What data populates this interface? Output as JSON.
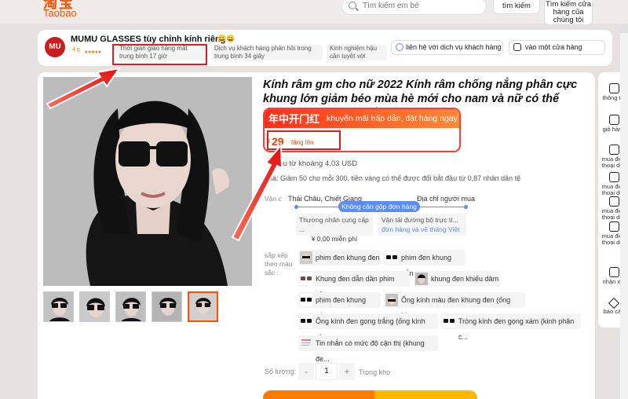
{
  "header": {
    "logo_cn": "淘宝",
    "logo_text": "Taobao",
    "search_placeholder": "Tìm kiếm em bé",
    "search_button": "tìm kiếm",
    "search_store_button": "Tìm kiếm cửa hàng của chúng tôi"
  },
  "shop": {
    "avatar_text": "MU",
    "name": "MUMU GLASSES tùy chỉnh kính riêng",
    "badge_emoji": "😀😀",
    "level": "4 g",
    "stars": "★★★★★",
    "metrics": [
      "Thời gian giao hàng mất trung bình 17 giờ",
      "Dịch vụ khách hàng phản hồi trong trung bình 34 giây",
      "Kinh nghiệm hậu cần tuyệt vời"
    ],
    "contact_button": "liên hệ với dịch vụ khách hàng",
    "store_button": "vào một cửa hàng"
  },
  "product": {
    "title": "Kính râm gm cho nữ 2022 Kính râm chống nắng phân cực khung lớn giảm béo mùa hè mới cho nam và nữ có thể được trang bị kính cận...",
    "promo_cn": "年中开门红",
    "promo_vn": "khuyến mãi hấp dẫn, đặt hàng ngay",
    "currency": "¥",
    "price": "29",
    "price_note": "tăng lên",
    "usd_note": "đầu từ khoảng 4,03 USD",
    "discount": "giá:  Giảm 50 cho mỗi 300, tiền vàng có thể được đổi bắt đầu từ 0,87 nhân dân tệ"
  },
  "shipping": {
    "label": "Vận c",
    "from": "Thái Châu, Chiết Giang",
    "to": "Địa chỉ người mua",
    "pill": "Không cần gộp đơn hàng",
    "card1_title": "Thương nhân cung cấp ...",
    "card1_value": "¥ 0,00 miễn phí",
    "card2_title": "Vận tải đường bộ trực tí...",
    "card2_value": "đơn hàng và về tháng Việt"
  },
  "options": {
    "label": "sắp xếp theo màu sắc :",
    "items": [
      "phim đen khung đen",
      "phim đen khung trắng",
      "Khung đen dẫn dần phim hồng",
      "khung đen khiếu dâm",
      "phim đen khung xám",
      "Ống kính màu đen khung đen (ống kín...",
      "Ống kính đen gọng trắng (ống kính ph...",
      "Tròng kính đen gọng xám (kính phân c...",
      "Tin nhắn có mức độ cận thị (khung đe..."
    ]
  },
  "quantity": {
    "label": "Số lượng:",
    "minus": "-",
    "value": "1",
    "plus": "+",
    "stock": "Trong kho"
  },
  "rail": {
    "items": [
      "thông tin",
      "giỏ hàng",
      "mua điện thoại di d",
      "mua điện thoại di d",
      "mua điện thoại di d",
      "mua điện thoại di d",
      "nhận xét",
      "báo cáo"
    ]
  },
  "colors": {
    "accent": "#ff5000",
    "price_red": "#ff3d00",
    "highlight_box": "#e21c1c",
    "ship_blue": "#5b8cf7"
  }
}
